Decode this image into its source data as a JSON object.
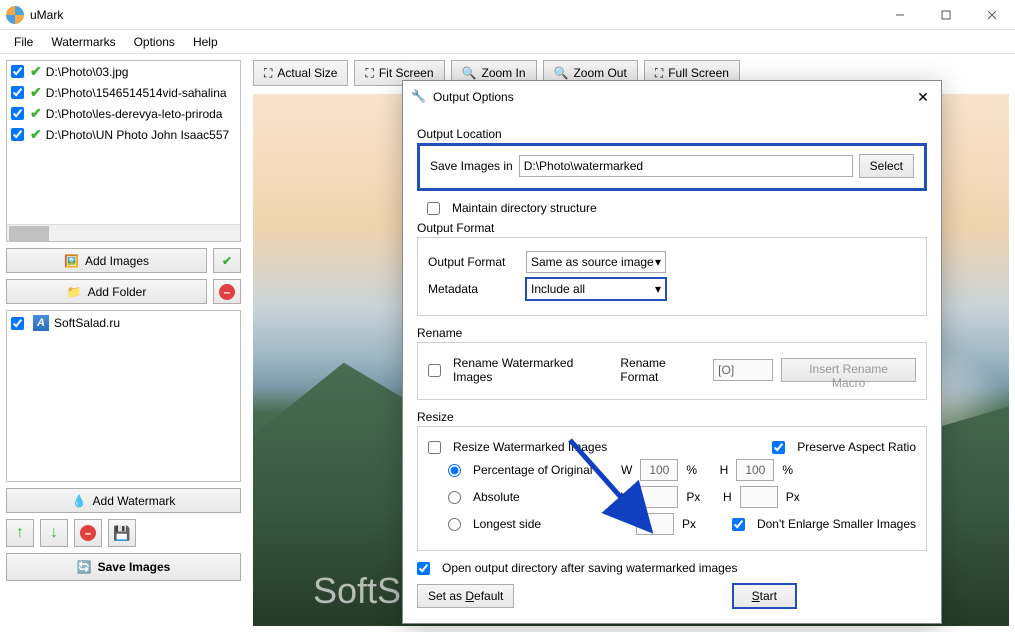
{
  "app": {
    "title": "uMark"
  },
  "menu": {
    "file": "File",
    "watermarks": "Watermarks",
    "options": "Options",
    "help": "Help"
  },
  "files": [
    {
      "name": "D:\\Photo\\03.jpg"
    },
    {
      "name": "D:\\Photo\\1546514514vid-sahalina"
    },
    {
      "name": "D:\\Photo\\les-derevya-leto-priroda"
    },
    {
      "name": "D:\\Photo\\UN Photo John Isaac557"
    }
  ],
  "sidebar": {
    "add_images": "Add Images",
    "add_folder": "Add Folder",
    "watermark_name": "SoftSalad.ru",
    "add_watermark": "Add Watermark",
    "save_images": "Save Images"
  },
  "toolbar": {
    "actual_size": "Actual Size",
    "fit_screen": "Fit Screen",
    "zoom_in": "Zoom In",
    "zoom_out": "Zoom Out",
    "full_screen": "Full Screen"
  },
  "preview": {
    "watermark_text": "SoftSalad.ru"
  },
  "modal": {
    "title": "Output Options",
    "location": {
      "section": "Output Location",
      "save_in_label": "Save Images in",
      "path": "D:\\Photo\\watermarked",
      "select": "Select",
      "maintain": "Maintain directory structure"
    },
    "format": {
      "section": "Output Format",
      "format_label": "Output Format",
      "format_value": "Same as source image",
      "metadata_label": "Metadata",
      "metadata_value": "Include all"
    },
    "rename": {
      "section": "Rename",
      "rename_cb": "Rename Watermarked Images",
      "format_label": "Rename Format",
      "format_value": "[O]",
      "macro_btn": "Insert Rename Macro"
    },
    "resize": {
      "section": "Resize",
      "resize_cb": "Resize Watermarked Images",
      "aspect_cb": "Preserve Aspect Ratio",
      "pct_label": "Percentage of Original",
      "w": "W",
      "h": "H",
      "px": "Px",
      "pct": "%",
      "w_pct": "100",
      "h_pct": "100",
      "abs_label": "Absolute",
      "longest_label": "Longest side",
      "enlarge_cb": "Don't Enlarge Smaller Images"
    },
    "open_after": "Open output directory after saving watermarked images",
    "set_default": "Set as Default",
    "start": "Start"
  }
}
